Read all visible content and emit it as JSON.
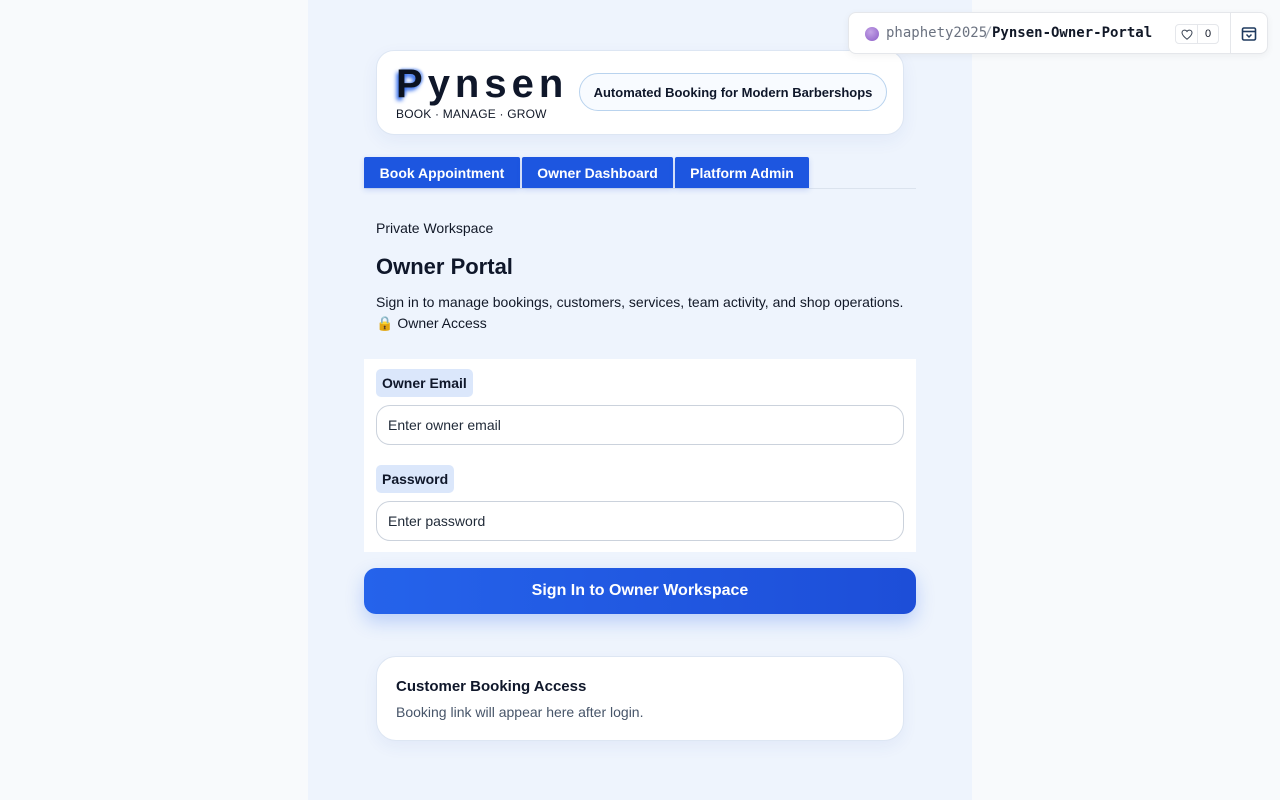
{
  "brand": {
    "logo_first": "P",
    "logo_rest": "ynsen",
    "tagline": "BOOK · MANAGE · GROW",
    "pill": "Automated Booking for Modern Barbershops"
  },
  "tabs": [
    {
      "label": "Book Appointment"
    },
    {
      "label": "Owner Dashboard"
    },
    {
      "label": "Platform Admin"
    }
  ],
  "header": {
    "eyebrow": "Private Workspace",
    "title": "Owner Portal",
    "description": "Sign in to manage bookings, customers, services, team activity, and shop operations.",
    "access_icon": "🔒",
    "access_text": "Owner Access"
  },
  "form": {
    "email_label": "Owner Email",
    "email_placeholder": "Enter owner email",
    "password_label": "Password",
    "password_placeholder": "Enter password",
    "submit_label": "Sign In to Owner Workspace"
  },
  "booking": {
    "title": "Customer Booking Access",
    "text": "Booking link will appear here after login."
  },
  "repo": {
    "owner": "phaphety2025",
    "separator": "/",
    "name": "Pynsen-Owner-Portal",
    "likes": "0"
  },
  "colors": {
    "accent": "#1d56e0",
    "page_bg": "#f8fafc",
    "column_bg": "#eef4fd"
  }
}
